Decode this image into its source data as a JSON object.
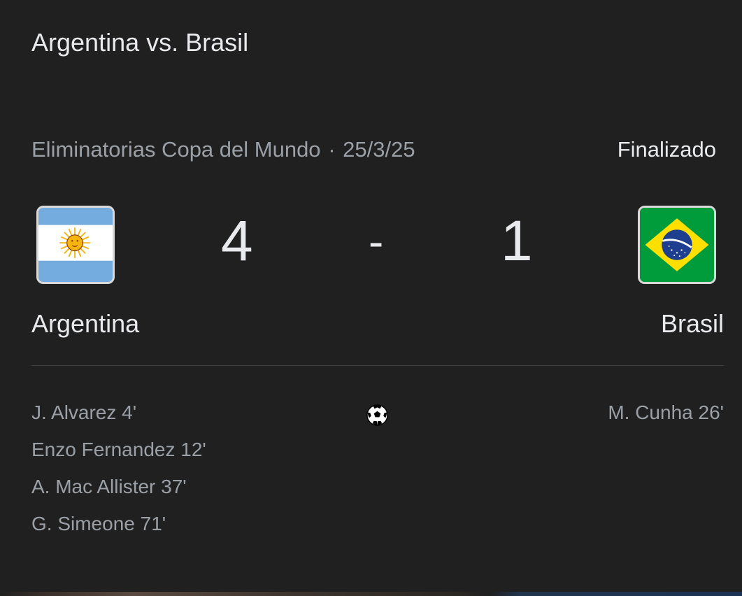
{
  "header": {
    "title": "Argentina vs. Brasil"
  },
  "match": {
    "competition": "Eliminatorias Copa del Mundo",
    "separator": "·",
    "date": "25/3/25",
    "status": "Finalizado",
    "home": {
      "name": "Argentina",
      "score": "4",
      "flag_icon": "argentina-flag-icon",
      "scorers": [
        "J. Alvarez 4'",
        "Enzo Fernandez 12'",
        "A. Mac Allister 37'",
        "G. Simeone 71'"
      ]
    },
    "away": {
      "name": "Brasil",
      "score": "1",
      "flag_icon": "brazil-flag-icon",
      "scorers": [
        "M. Cunha 26'"
      ]
    },
    "score_separator": "-",
    "goal_icon": "soccer-ball-icon"
  },
  "colors": {
    "background": "#202020",
    "primary_text": "#e8eaed",
    "secondary_text": "#9aa0a6",
    "divider": "#3c4043"
  }
}
